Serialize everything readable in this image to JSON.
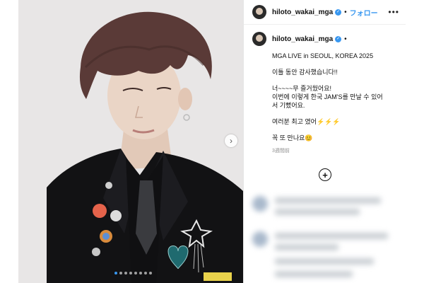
{
  "profile": {
    "username": "hiloto_wakai_mga",
    "follow_label": "フォロー",
    "separator": "•"
  },
  "post": {
    "caption_username": "hiloto_wakai_mga",
    "lines": [
      "MGA LIVE in SEOUL, KOREA 2025",
      "이틀 동안 감사했습니다!!",
      "너~~~~무 즐거웠어요!\n이번에 이렇게 한국 JAM'S를 만날 수 있어\n서 기뻤어요.",
      "여러분 최고 였어⚡⚡⚡",
      "꼭 또 만나요😊"
    ],
    "time_ago": "3週間前"
  },
  "carousel": {
    "dot_count": 8,
    "active_index": 0
  },
  "icons": {
    "verified": "verified-badge-icon",
    "more": "more-options-icon",
    "next": "chevron-right-icon",
    "load_more": "plus-circle-icon"
  },
  "colors": {
    "accent": "#3897f0",
    "blazer": "#121214",
    "hair": "#5a3a37"
  }
}
